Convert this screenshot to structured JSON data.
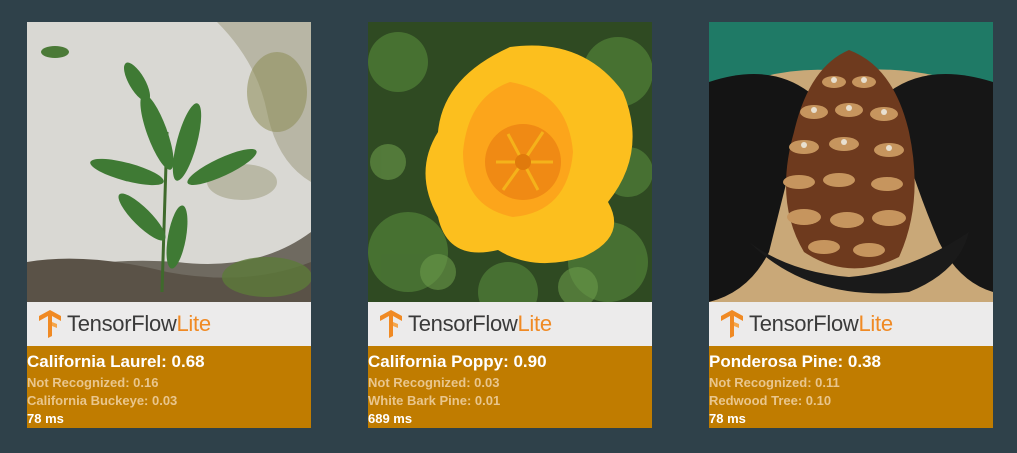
{
  "colors": {
    "background": "#2f414a",
    "results_panel": "#c07c00",
    "banner": "#ecebeb",
    "tf_orange": "#f08a24"
  },
  "branding": {
    "name_main": "TensorFlow",
    "name_suffix": "Lite",
    "icon": "tensorflow-logo-icon"
  },
  "cards": [
    {
      "photo": "california-laurel-on-rock",
      "top": "California Laurel: 0.68",
      "second": "Not Recognized: 0.16",
      "third": "California Buckeye: 0.03",
      "time": "78 ms"
    },
    {
      "photo": "california-poppy-flower",
      "top": "California Poppy: 0.90",
      "second": "Not Recognized: 0.03",
      "third": "White Bark Pine: 0.01",
      "time": "689 ms"
    },
    {
      "photo": "pine-cone-in-gloved-hands",
      "top": "Ponderosa Pine: 0.38",
      "second": "Not Recognized: 0.11",
      "third": "Redwood Tree: 0.10",
      "time": "78 ms"
    }
  ]
}
